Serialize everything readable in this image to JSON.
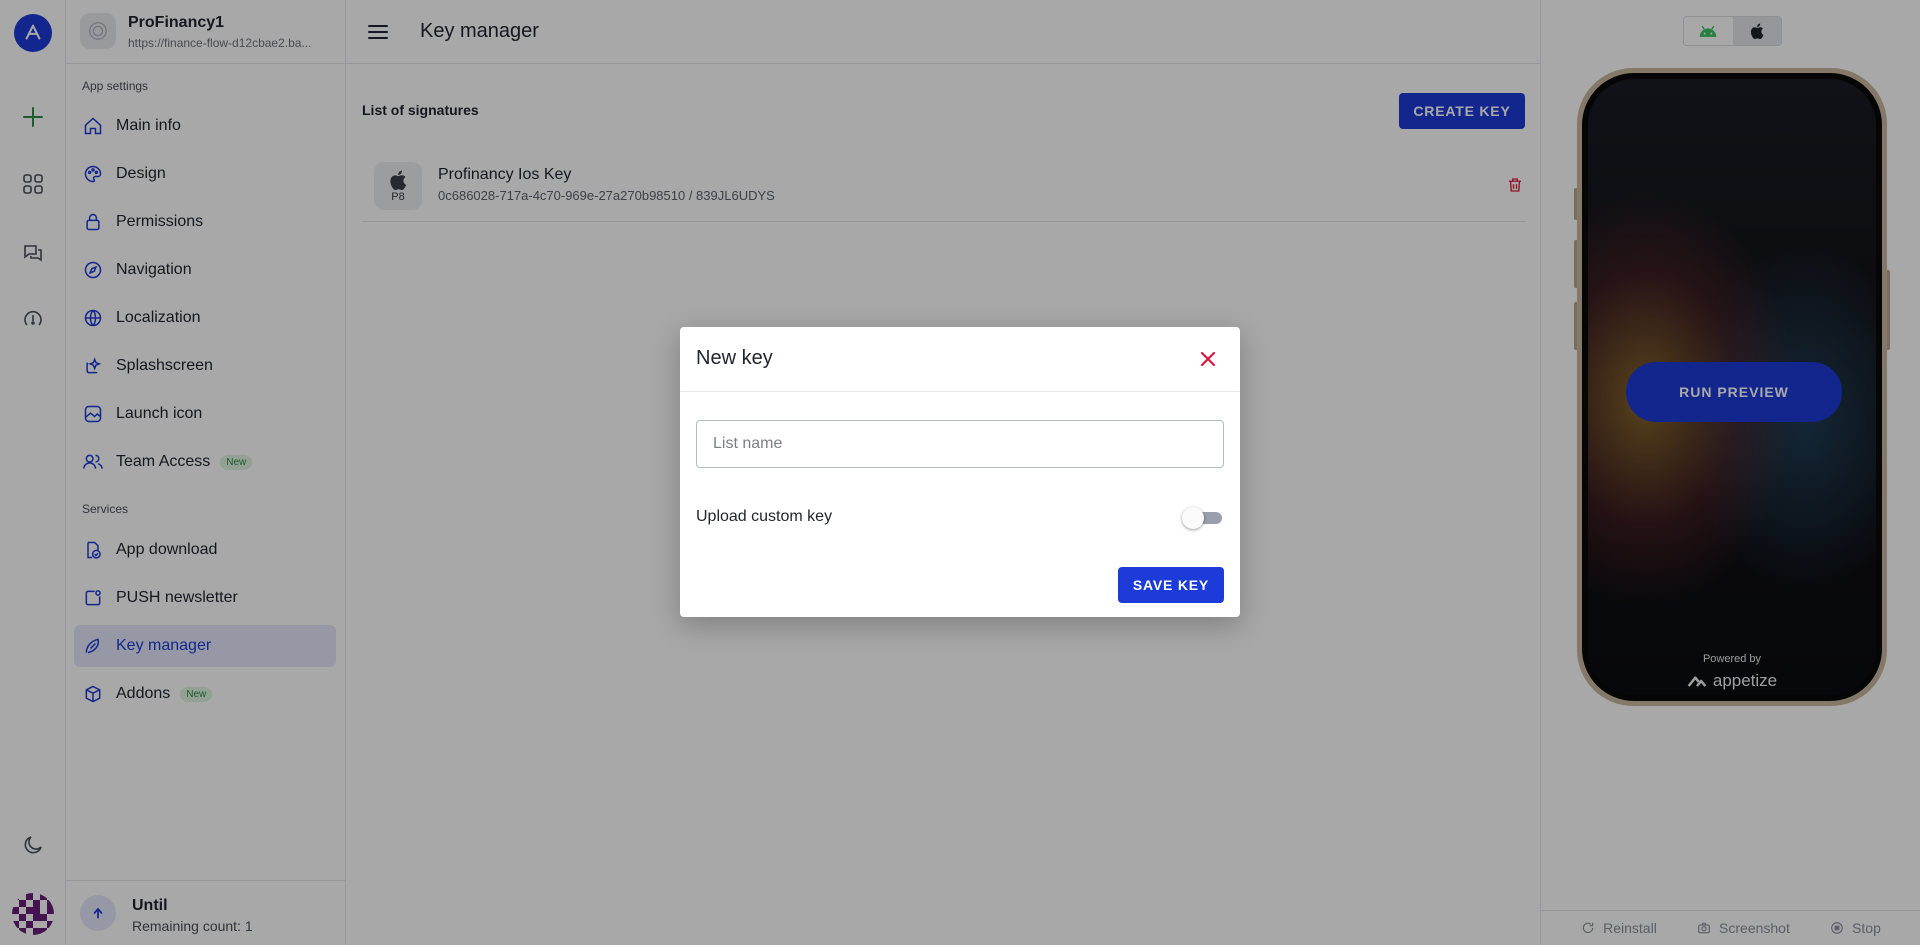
{
  "app": {
    "name": "ProFinancy1",
    "url": "https://finance-flow-d12cbae2.ba..."
  },
  "sidebar": {
    "section_app_settings": "App settings",
    "section_services": "Services",
    "items": [
      {
        "label": "Main info",
        "icon": "home-icon"
      },
      {
        "label": "Design",
        "icon": "palette-icon"
      },
      {
        "label": "Permissions",
        "icon": "lock-icon"
      },
      {
        "label": "Navigation",
        "icon": "compass-icon"
      },
      {
        "label": "Localization",
        "icon": "globe-icon"
      },
      {
        "label": "Splashscreen",
        "icon": "sparkle-icon"
      },
      {
        "label": "Launch icon",
        "icon": "image-icon"
      },
      {
        "label": "Team Access",
        "icon": "users-icon",
        "badge": "New"
      }
    ],
    "services": [
      {
        "label": "App download",
        "icon": "download-icon"
      },
      {
        "label": "PUSH newsletter",
        "icon": "push-icon"
      },
      {
        "label": "Key manager",
        "icon": "key-icon",
        "active": true
      },
      {
        "label": "Addons",
        "icon": "box-icon",
        "badge": "New"
      }
    ]
  },
  "plan": {
    "title": "Until",
    "remaining": "Remaining count: 1"
  },
  "main": {
    "title": "Key manager",
    "list_title": "List of signatures",
    "create_label": "CREATE KEY",
    "keys": [
      {
        "name": "Profinancy Ios Key",
        "id": "0c686028-717a-4c70-969e-27a270b98510 / 839JL6UDYS",
        "type": "P8"
      }
    ]
  },
  "preview": {
    "run_label": "RUN PREVIEW",
    "powered_by": "Powered by",
    "brand": "appetize",
    "footer": {
      "reinstall": "Reinstall",
      "screenshot": "Screenshot",
      "stop": "Stop"
    }
  },
  "dialog": {
    "title": "New key",
    "input_placeholder": "List name",
    "input_value": "",
    "upload_label": "Upload custom key",
    "upload_enabled": false,
    "save_label": "SAVE KEY"
  },
  "colors": {
    "accent": "#1d3bd8",
    "danger": "#e0183c",
    "badge_green": "#2e8b47"
  }
}
